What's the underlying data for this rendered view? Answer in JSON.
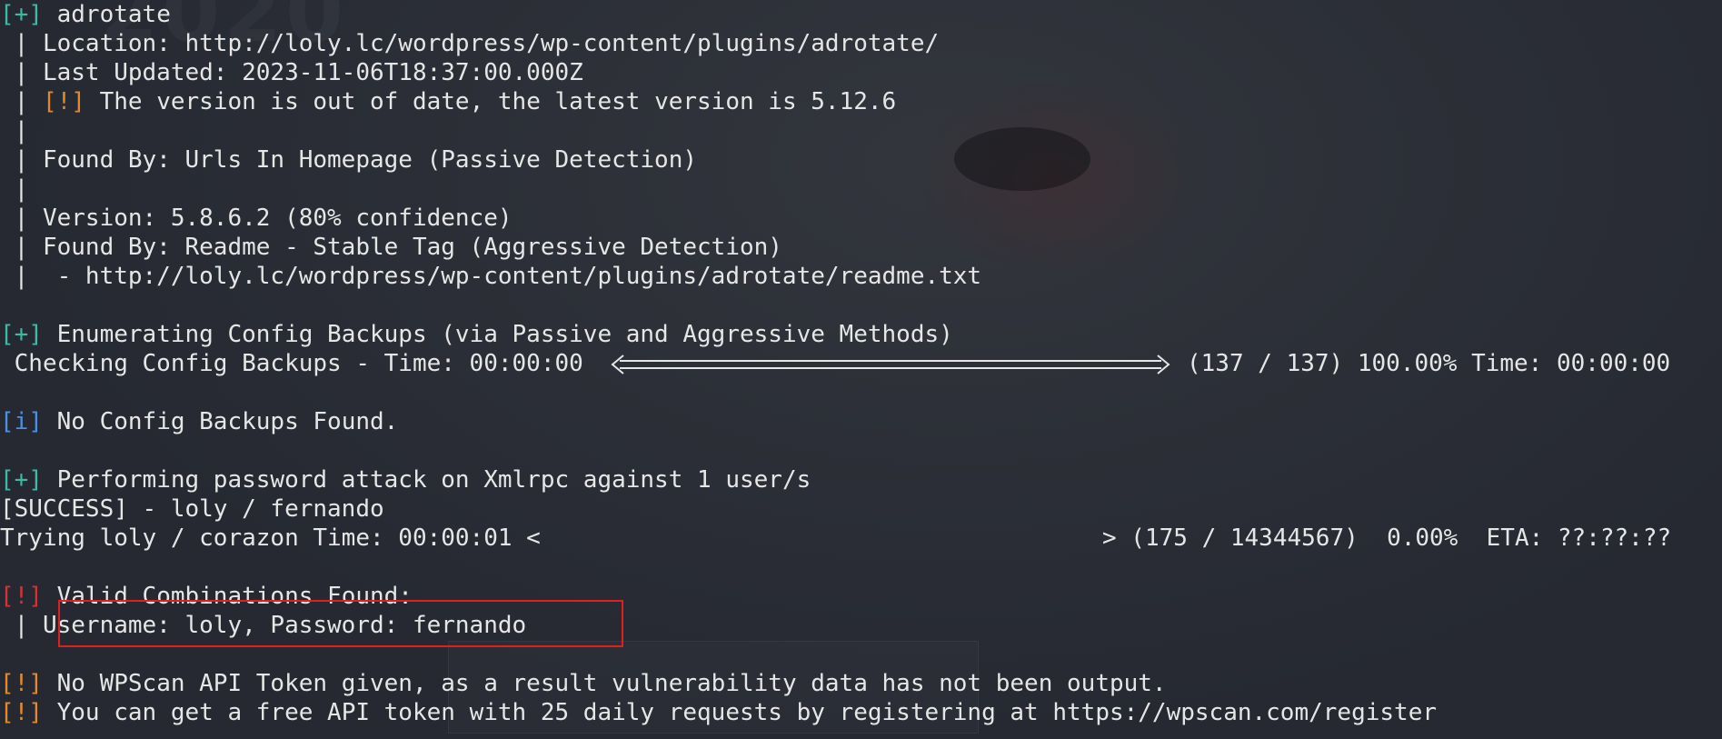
{
  "terminal": {
    "watermark": "2020",
    "lines": {
      "l1_tag": "[+]",
      "l1_text": " adrotate",
      "l2": " | Location: http://loly.lc/wordpress/wp-content/plugins/adrotate/",
      "l3": " | Last Updated: 2023-11-06T18:37:00.000Z",
      "l4_pre": " | ",
      "l4_tag": "[!]",
      "l4_text": " The version is out of date, the latest version is 5.12.6",
      "l5": " |",
      "l6": " | Found By: Urls In Homepage (Passive Detection)",
      "l7": " |",
      "l8": " | Version: 5.8.6.2 (80% confidence)",
      "l9": " | Found By: Readme - Stable Tag (Aggressive Detection)",
      "l10": " |  - http://loly.lc/wordpress/wp-content/plugins/adrotate/readme.txt",
      "l11_tag": "[+]",
      "l11_text": " Enumerating Config Backups (via Passive and Aggressive Methods)",
      "l12_left": " Checking Config Backups - Time: 00:00:00",
      "l12_right": "(137 / 137) 100.00% Time: 00:00:00",
      "l13_tag": "[i]",
      "l13_text": " No Config Backups Found.",
      "l14_tag": "[+]",
      "l14_text": " Performing password attack on Xmlrpc against 1 user/s",
      "l15": "[SUCCESS] - loly / fernando",
      "l16_left": "Trying loly / corazon Time: 00:00:01 <",
      "l16_right": "> (175 / 14344567)  0.00%  ETA: ??:??:??",
      "l17_tag": "[!]",
      "l17_text": " Valid Combinations Found:",
      "l18": " | Username: loly, Password: fernando",
      "l19_tag": "[!]",
      "l19_text": " No WPScan API Token given, as a result vulnerability data has not been output.",
      "l20_tag": "[!]",
      "l20_text": " You can get a free API token with 25 daily requests by registering at https://wpscan.com/register"
    }
  },
  "colors": {
    "background": "#272a33",
    "text": "#e6e6e6",
    "tag_plus": "#3fb8a4",
    "tag_warning": "#e08a2a",
    "tag_error": "#d0333a",
    "tag_info": "#4e8fe0",
    "highlight_box": "#e02020"
  }
}
